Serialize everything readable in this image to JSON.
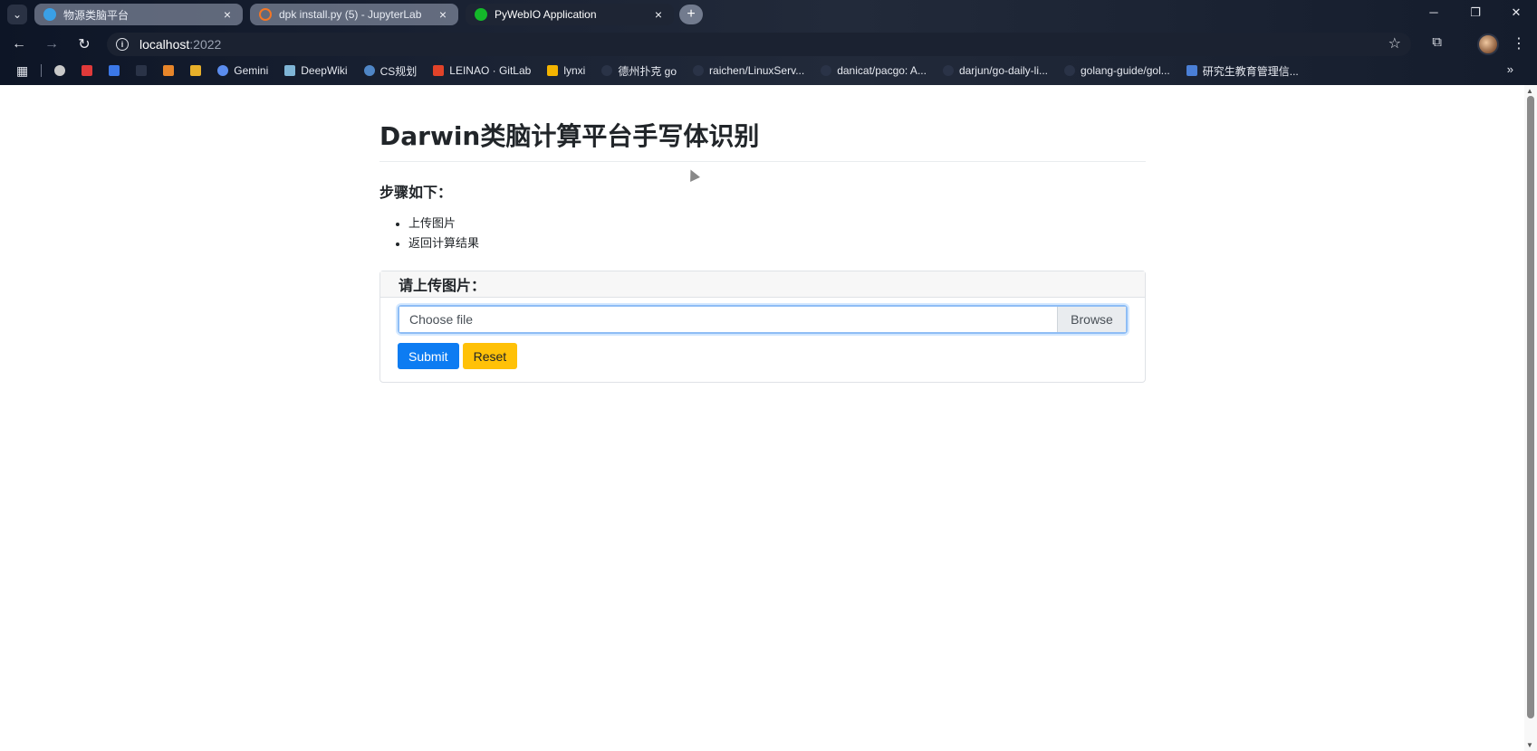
{
  "browser": {
    "tabs": [
      {
        "title": "物源类脑平台",
        "state": "inactive",
        "favicon_color": "#3aa0e6"
      },
      {
        "title": "dpk install.py (5) - JupyterLab",
        "state": "inactive",
        "favicon_color": "#f37626"
      },
      {
        "title": "PyWebIO Application",
        "state": "active",
        "favicon_color": "#14b82a"
      }
    ],
    "new_tab_label": "+",
    "window_controls": {
      "minimize": "─",
      "restore": "❐",
      "close": "✕"
    },
    "url_host": "localhost",
    "url_port": ":2022",
    "bookmarks": [
      {
        "label": "",
        "icon_color": "#c9c9c9"
      },
      {
        "label": "",
        "icon_color": "#e03a3a"
      },
      {
        "label": "",
        "icon_color": "#3b78e7"
      },
      {
        "label": "",
        "icon_color": "#2a3347"
      },
      {
        "label": "",
        "icon_color": "#e8862a"
      },
      {
        "label": "",
        "icon_color": "#e8b02a"
      },
      {
        "label": "Gemini",
        "icon_color": "#5b8def"
      },
      {
        "label": "DeepWiki",
        "icon_color": "#7fb5d6"
      },
      {
        "label": "CS规划",
        "icon_color": "#4f86c6"
      },
      {
        "label": "LEINAO · GitLab",
        "icon_color": "#e24329"
      },
      {
        "label": "lynxi",
        "icon_color": "#f4b400"
      },
      {
        "label": "德州扑克 go",
        "icon_color": "#2a3347"
      },
      {
        "label": "raichen/LinuxServ...",
        "icon_color": "#2a3347"
      },
      {
        "label": "danicat/pacgo: A...",
        "icon_color": "#2a3347"
      },
      {
        "label": "darjun/go-daily-li...",
        "icon_color": "#2a3347"
      },
      {
        "label": "golang-guide/gol...",
        "icon_color": "#2a3347"
      },
      {
        "label": "研究生教育管理信...",
        "icon_color": "#4a7fd6"
      }
    ],
    "bookmarks_more": "»"
  },
  "page": {
    "title": "Darwin类脑计算平台手写体识别",
    "steps_heading": "步骤如下：",
    "steps": [
      "上传图片",
      "返回计算结果"
    ],
    "card": {
      "header": "请上传图片：",
      "file_placeholder": "Choose file",
      "browse_label": "Browse",
      "submit_label": "Submit",
      "reset_label": "Reset"
    }
  }
}
